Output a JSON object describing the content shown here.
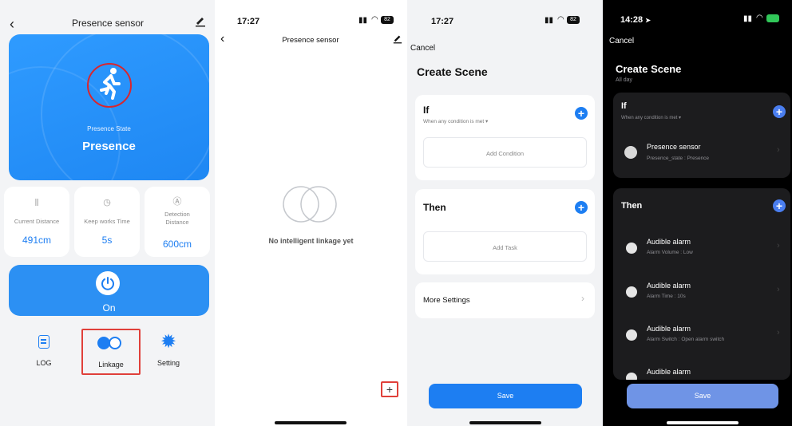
{
  "panel1": {
    "header_title": "Presence sensor",
    "state_label": "Presence State",
    "state_value": "Presence",
    "stats": [
      {
        "label": "Current Distance",
        "value": "491cm"
      },
      {
        "label": "Keep works Time",
        "value": "5s"
      },
      {
        "label": "Detection Distance",
        "value": "600cm"
      }
    ],
    "power_label": "On",
    "nav": [
      {
        "label": "LOG"
      },
      {
        "label": "Linkage"
      },
      {
        "label": "Setting"
      }
    ]
  },
  "panel2": {
    "time": "17:27",
    "battery": "82",
    "header_title": "Presence sensor",
    "empty_text": "No intelligent linkage yet"
  },
  "panel3": {
    "time": "17:27",
    "battery": "82",
    "cancel": "Cancel",
    "title": "Create Scene",
    "if_label": "If",
    "if_sub": "When any condition is met ▾",
    "add_condition": "Add Condition",
    "then_label": "Then",
    "add_task": "Add Task",
    "more_settings": "More Settings",
    "save": "Save"
  },
  "panel4": {
    "time": "14:28",
    "cancel": "Cancel",
    "title": "Create Scene",
    "subtitle": "All day",
    "if_label": "If",
    "if_sub": "When any condition is met ▾",
    "condition": {
      "name": "Presence sensor",
      "detail": "Presence_state : Presence"
    },
    "then_label": "Then",
    "tasks": [
      {
        "name": "Audible alarm",
        "detail": "Alarm Volume : Low"
      },
      {
        "name": "Audible alarm",
        "detail": "Alarm Time : 10s"
      },
      {
        "name": "Audible alarm",
        "detail": "Alarm Switch : Open alarm switch"
      },
      {
        "name": "Audible alarm",
        "detail": ""
      }
    ],
    "save": "Save"
  }
}
